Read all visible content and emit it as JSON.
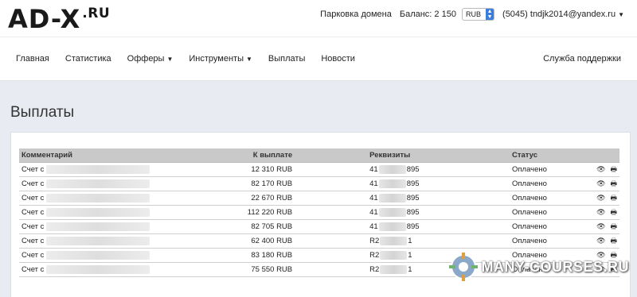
{
  "brand": {
    "logo_main": "AD-X",
    "logo_suffix": ".RU"
  },
  "topbar": {
    "parking_link": "Парковка домена",
    "balance_label": "Баланс: 2 150",
    "currency": "RUB",
    "user": "(5045) tndjk2014@yandex.ru"
  },
  "nav": {
    "items": [
      {
        "label": "Главная"
      },
      {
        "label": "Статистика"
      },
      {
        "label": "Офферы"
      },
      {
        "label": "Инструменты"
      },
      {
        "label": "Выплаты"
      },
      {
        "label": "Новости"
      }
    ],
    "support": "Служба поддержки"
  },
  "page": {
    "title": "Выплаты"
  },
  "table": {
    "headers": {
      "comment": "Комментарий",
      "amount": "К выплате",
      "requisites": "Реквизиты",
      "status": "Статус"
    },
    "rows": [
      {
        "comment": "Счет с",
        "amount": "12 310 RUB",
        "req_prefix": "41",
        "req_suffix": "895",
        "status": "Оплачено"
      },
      {
        "comment": "Счет с",
        "amount": "82 170 RUB",
        "req_prefix": "41",
        "req_suffix": "895",
        "status": "Оплачено"
      },
      {
        "comment": "Счет с",
        "amount": "22 670 RUB",
        "req_prefix": "41",
        "req_suffix": "895",
        "status": "Оплачено"
      },
      {
        "comment": "Счет с",
        "amount": "112 220 RUB",
        "req_prefix": "41",
        "req_suffix": "895",
        "status": "Оплачено"
      },
      {
        "comment": "Счет с",
        "amount": "82 705 RUB",
        "req_prefix": "41",
        "req_suffix": "895",
        "status": "Оплачено"
      },
      {
        "comment": "Счет с",
        "amount": "62 400 RUB",
        "req_prefix": "R2",
        "req_suffix": "1",
        "status": "Оплачено"
      },
      {
        "comment": "Счет с",
        "amount": "83 180 RUB",
        "req_prefix": "R2",
        "req_suffix": "1",
        "status": "Оплачено"
      },
      {
        "comment": "Счет с",
        "amount": "75 550 RUB",
        "req_prefix": "R2",
        "req_suffix": "1",
        "status": "Оплачено"
      }
    ]
  },
  "watermark": {
    "text": "MANY-COURSES.RU"
  },
  "colors": {
    "status_paid": "#2fa52f",
    "content_bg": "#e8ebf1",
    "header_bg": "#c9c9c9",
    "accent": "#3b7ddd"
  },
  "icons": {
    "view": "eye-icon",
    "print": "print-icon"
  }
}
